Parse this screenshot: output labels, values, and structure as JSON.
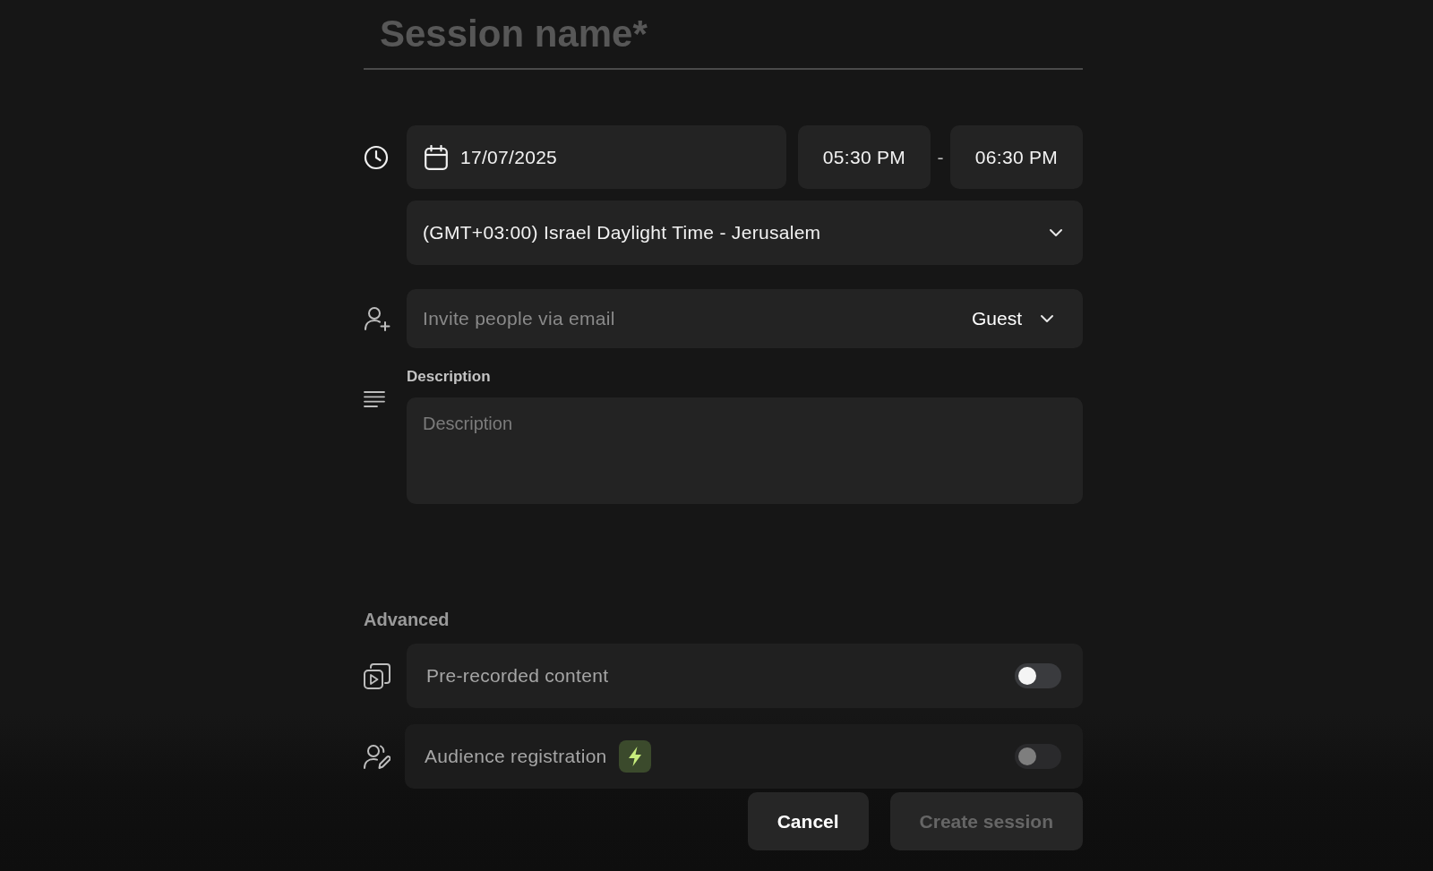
{
  "session_name": {
    "placeholder": "Session name*"
  },
  "schedule": {
    "date": "17/07/2025",
    "start_time": "05:30 PM",
    "separator": "-",
    "end_time": "06:30 PM",
    "timezone": "(GMT+03:00) Israel Daylight Time - Jerusalem"
  },
  "invite": {
    "placeholder": "Invite people via email",
    "role": "Guest"
  },
  "description": {
    "label": "Description",
    "placeholder": "Description"
  },
  "advanced": {
    "heading": "Advanced",
    "options": [
      {
        "label": "Pre-recorded content",
        "kind": "standard",
        "on": false,
        "disabled": false
      },
      {
        "label": "Audience registration",
        "kind": "premium",
        "on": false,
        "disabled": true
      }
    ]
  },
  "buttons": [
    {
      "label": "Cancel",
      "disabled": false
    },
    {
      "label": "Create session",
      "disabled": true
    }
  ]
}
